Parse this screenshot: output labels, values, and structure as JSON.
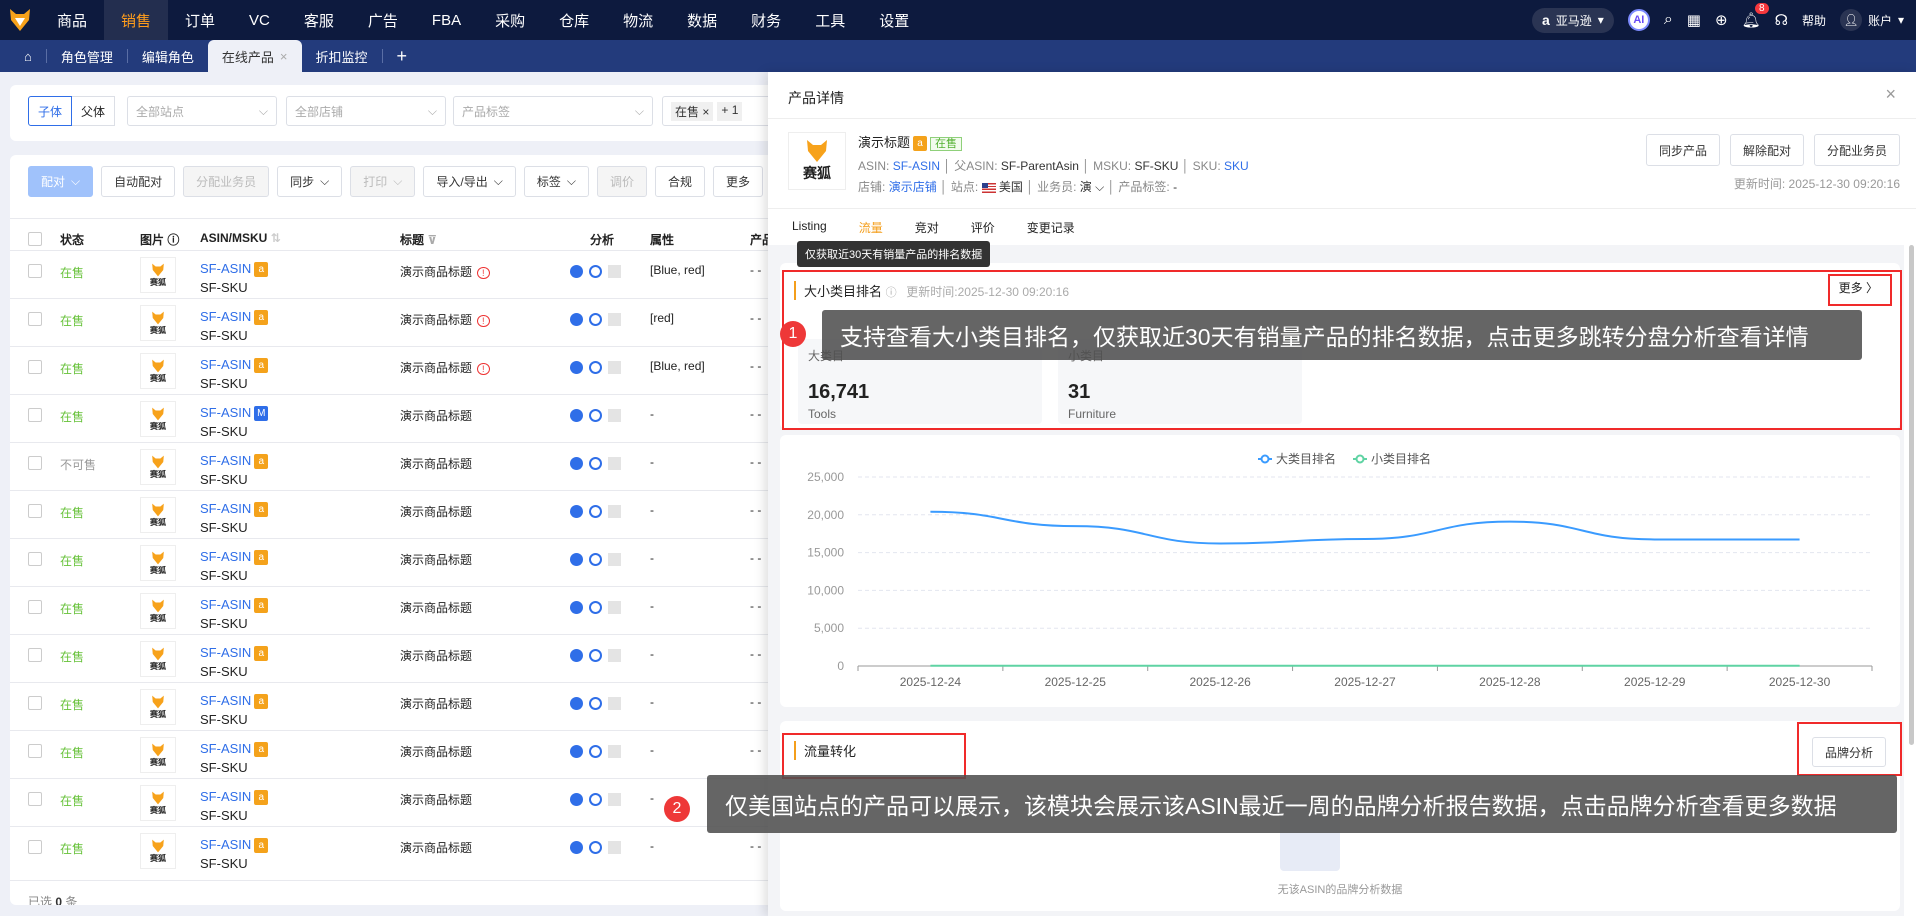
{
  "topnav": {
    "items": [
      "商品",
      "销售",
      "订单",
      "VC",
      "客服",
      "广告",
      "FBA",
      "采购",
      "仓库",
      "物流",
      "数据",
      "财务",
      "工具",
      "设置"
    ],
    "active": 1,
    "platform": "亚马逊",
    "ai": "AI",
    "notifications": "8",
    "help": "帮助",
    "account": "账户"
  },
  "tabs": {
    "items": [
      "角色管理",
      "编辑角色",
      "在线产品",
      "折扣监控"
    ],
    "active_close": "×",
    "add": "+"
  },
  "filters": {
    "child": "子体",
    "parent": "父体",
    "site_placeholder": "全部站点",
    "shop_placeholder": "全部店铺",
    "tag_placeholder": "产品标签",
    "status_tag": "在售",
    "more_count": "+ 1"
  },
  "toolbar": [
    "配对",
    "自动配对",
    "分配业务员",
    "同步",
    "打印",
    "导入/导出",
    "标签",
    "调价",
    "合规",
    "更多"
  ],
  "table": {
    "headers": [
      "状态",
      "图片",
      "ASIN/MSKU",
      "标题",
      "分析",
      "属性",
      "产品"
    ],
    "rows": [
      {
        "status": "在售",
        "asin": "SF-ASIN",
        "badge": "a",
        "sku": "SF-SKU",
        "title": "演示商品标题",
        "warn": true,
        "attr": "[Blue, red]",
        "prod": "- -"
      },
      {
        "status": "在售",
        "asin": "SF-ASIN",
        "badge": "a",
        "sku": "SF-SKU",
        "title": "演示商品标题",
        "warn": true,
        "attr": "[red]",
        "prod": "- -"
      },
      {
        "status": "在售",
        "asin": "SF-ASIN",
        "badge": "a",
        "sku": "SF-SKU",
        "title": "演示商品标题",
        "warn": true,
        "attr": "[Blue, red]",
        "prod": "- -"
      },
      {
        "status": "在售",
        "asin": "SF-ASIN",
        "badge": "M",
        "sku": "SF-SKU",
        "title": "演示商品标题",
        "warn": false,
        "attr": "-",
        "prod": "- -"
      },
      {
        "status": "不可售",
        "asin": "SF-ASIN",
        "badge": "a",
        "sku": "SF-SKU",
        "title": "演示商品标题",
        "warn": false,
        "attr": "-",
        "prod": "- -"
      },
      {
        "status": "在售",
        "asin": "SF-ASIN",
        "badge": "a",
        "sku": "SF-SKU",
        "title": "演示商品标题",
        "warn": false,
        "attr": "-",
        "prod": "- -"
      },
      {
        "status": "在售",
        "asin": "SF-ASIN",
        "badge": "a",
        "sku": "SF-SKU",
        "title": "演示商品标题",
        "warn": false,
        "attr": "-",
        "prod": "- -"
      },
      {
        "status": "在售",
        "asin": "SF-ASIN",
        "badge": "a",
        "sku": "SF-SKU",
        "title": "演示商品标题",
        "warn": false,
        "attr": "-",
        "prod": "- -"
      },
      {
        "status": "在售",
        "asin": "SF-ASIN",
        "badge": "a",
        "sku": "SF-SKU",
        "title": "演示商品标题",
        "warn": false,
        "attr": "-",
        "prod": "- -"
      },
      {
        "status": "在售",
        "asin": "SF-ASIN",
        "badge": "a",
        "sku": "SF-SKU",
        "title": "演示商品标题",
        "warn": false,
        "attr": "-",
        "prod": "- -"
      },
      {
        "status": "在售",
        "asin": "SF-ASIN",
        "badge": "a",
        "sku": "SF-SKU",
        "title": "演示商品标题",
        "warn": false,
        "attr": "-",
        "prod": "- -"
      },
      {
        "status": "在售",
        "asin": "SF-ASIN",
        "badge": "a",
        "sku": "SF-SKU",
        "title": "演示商品标题",
        "warn": false,
        "attr": "-",
        "prod": "- -"
      },
      {
        "status": "在售",
        "asin": "SF-ASIN",
        "badge": "a",
        "sku": "SF-SKU",
        "title": "演示商品标题",
        "warn": false,
        "attr": "-",
        "prod": "- -"
      }
    ],
    "footer_prefix": "已选",
    "footer_count": "0",
    "footer_suffix": "条"
  },
  "thumb_text": "赛狐",
  "drawer": {
    "title": "产品详情",
    "close": "×",
    "product": {
      "title": "演示标题",
      "status": "在售",
      "asin_label": "ASIN:",
      "asin": "SF-ASIN",
      "parent_label": "父ASIN:",
      "parent": "SF-ParentAsin",
      "msku_label": "MSKU:",
      "msku": "SF-SKU",
      "sku_label": "SKU:",
      "sku": "SKU",
      "shop_label": "店铺:",
      "shop": "演示店铺",
      "site_label": "站点:",
      "site": "美国",
      "sales_label": "业务员:",
      "sales": "演",
      "tag_label": "产品标签:",
      "tag": "-"
    },
    "buttons": [
      "同步产品",
      "解除配对",
      "分配业务员"
    ],
    "updated": "更新时间: 2025-12-30 09:20:16",
    "tabs": [
      "Listing",
      "流量",
      "竞对",
      "评价",
      "变更记录"
    ],
    "active_tab": 1,
    "tooltip": "仅获取近30天有销量产品的排名数据",
    "rank": {
      "title": "大小类目排名",
      "updated": "更新时间:2025-12-30 09:20:16",
      "more": "更多",
      "cards": [
        {
          "label": "大类目",
          "value": "16,741",
          "category": "Tools"
        },
        {
          "label": "小类目",
          "value": "31",
          "category": "Furniture"
        }
      ]
    },
    "traffic": {
      "title": "流量转化",
      "brand_button": "品牌分析",
      "empty": "无该ASIN的品牌分析数据"
    }
  },
  "annotations": [
    {
      "n": "1",
      "text": "支持查看大小类目排名，仅获取近30天有销量产品的排名数据，点击更多跳转分盘分析查看详情"
    },
    {
      "n": "2",
      "text": "仅美国站点的产品可以展示，该模块会展示该ASIN最近一周的品牌分析报告数据，点击品牌分析查看更多数据"
    }
  ],
  "chart_data": {
    "type": "line",
    "title": "",
    "categories": [
      "2025-12-24",
      "2025-12-25",
      "2025-12-26",
      "2025-12-27",
      "2025-12-28",
      "2025-12-29",
      "2025-12-30"
    ],
    "series": [
      {
        "name": "大类目排名",
        "color": "#3a9bff",
        "values": [
          20400,
          18500,
          16200,
          16800,
          19100,
          16741,
          16741
        ]
      },
      {
        "name": "小类目排名",
        "color": "#5fd3a3",
        "values": [
          31,
          31,
          31,
          31,
          31,
          31,
          31
        ]
      }
    ],
    "ylim": [
      0,
      25000
    ],
    "yticks": [
      "0",
      "5,000",
      "10,000",
      "15,000",
      "20,000",
      "25,000"
    ],
    "legend": "top-center",
    "grid": true
  }
}
